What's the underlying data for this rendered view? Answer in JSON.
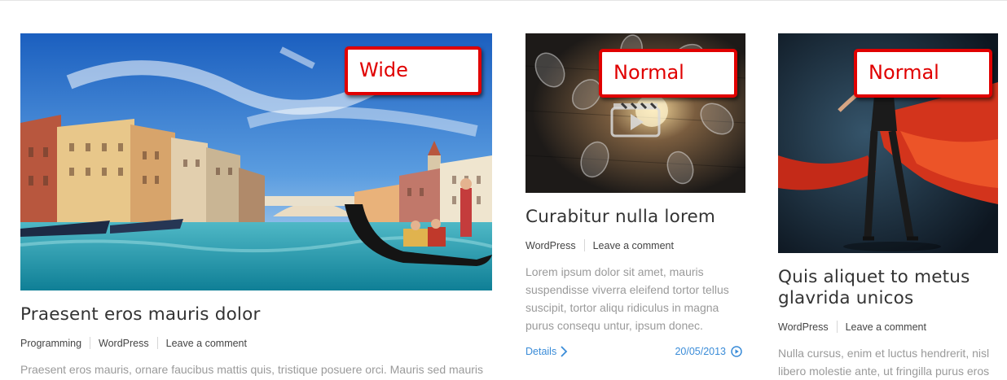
{
  "posts": [
    {
      "label": "Wide",
      "title": "Praesent eros mauris dolor",
      "categories": [
        "Programming",
        "WordPress"
      ],
      "comment_link": "Leave a comment",
      "excerpt": "Praesent eros mauris, ornare faucibus mattis quis, tristique posuere orci. Mauris sed mauris"
    },
    {
      "label": "Normal",
      "title": "Curabitur nulla lorem",
      "categories": [
        "WordPress"
      ],
      "comment_link": "Leave a comment",
      "excerpt": "Lorem ipsum dolor sit amet, mauris suspendisse viverra eleifend tortor tellus suscipit, tortor aliqu ridiculus in magna purus consequ untur, ipsum donec.",
      "details": "Details",
      "date": "20/05/2013"
    },
    {
      "label": "Normal",
      "title": "Quis aliquet to metus glavrida unicos",
      "categories": [
        "WordPress"
      ],
      "comment_link": "Leave a comment",
      "excerpt": "Nulla cursus, enim et luctus hendrerit, nisl libero molestie ante, ut fringilla purus eros"
    }
  ],
  "colors": {
    "accent": "#3a8cd8",
    "label_red": "#e00000"
  },
  "icons": {
    "video": "video-play-icon",
    "details_arrow": "chevron-right-icon",
    "date_play": "play-circle-icon"
  }
}
